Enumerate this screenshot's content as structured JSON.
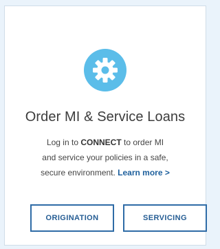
{
  "card": {
    "icon": "gear-icon",
    "title": "Order MI & Service Loans",
    "description": {
      "line1_prefix": "Log in to ",
      "line1_bold": "CONNECT",
      "line1_suffix": " to order MI",
      "line2": "and service your policies in a safe,",
      "line3": "secure environment. ",
      "learn_more": "Learn more >"
    },
    "buttons": {
      "origination": "ORIGINATION",
      "servicing": "SERVICING"
    }
  },
  "colors": {
    "background": "#eaf3fb",
    "icon_circle": "#5bbde9",
    "accent": "#2e6ba6",
    "link": "#1d5f9c"
  }
}
